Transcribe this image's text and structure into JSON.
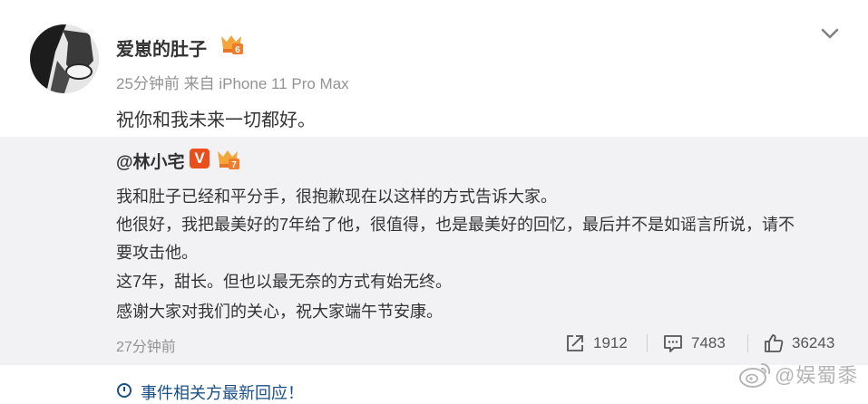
{
  "post": {
    "username": "爱崽的肚子",
    "meta": "25分钟前 来自 iPhone 11 Pro Max",
    "text": "祝你和我未来一切都好。",
    "medal_number": "6"
  },
  "repost": {
    "username": "@林小宅",
    "verified_label": "V",
    "medal_number": "7",
    "lines": [
      "我和肚子已经和平分手，很抱歉现在以这样的方式告诉大家。",
      "他很好，我把最美好的7年给了他，很值得，也是最美好的回忆，最后并不是如谣言所说，请不",
      "要攻击他。",
      "这7年，甜长。但也以最无奈的方式有始无终。",
      "感谢大家对我们的关心，祝大家端午节安康。"
    ],
    "time": "27分钟前",
    "actions": {
      "share_count": "1912",
      "comment_count": "7483",
      "like_count": "36243"
    }
  },
  "footer": {
    "text": "事件相关方最新回应！"
  },
  "watermark": {
    "text": "@娱蜀黍"
  }
}
